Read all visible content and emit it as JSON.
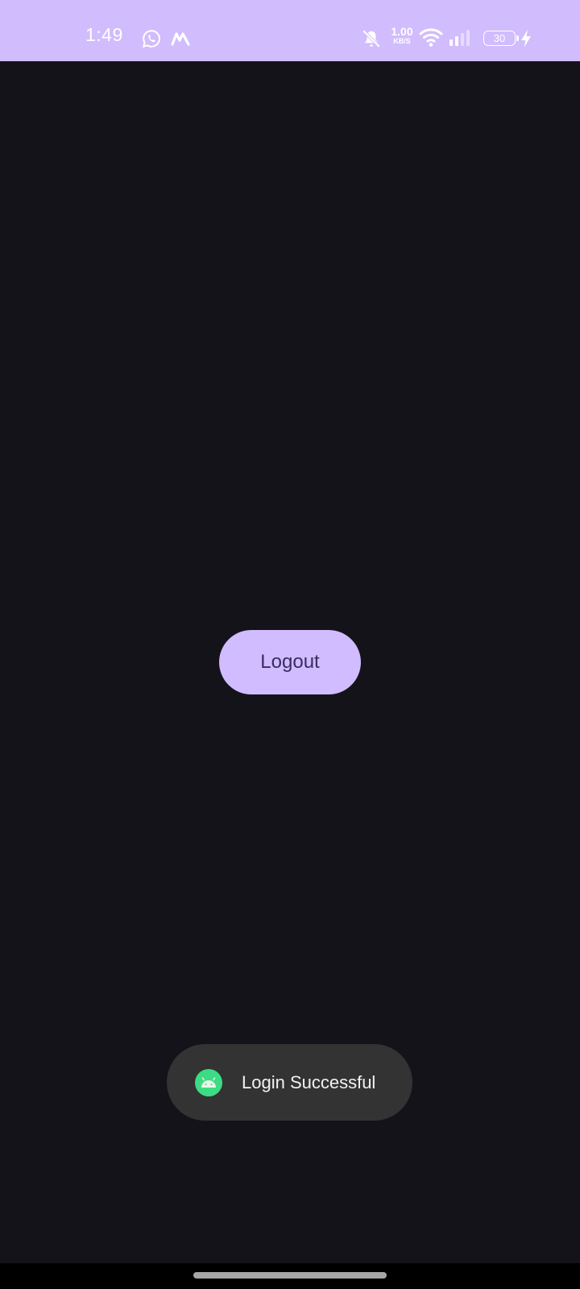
{
  "status_bar": {
    "time": "1:49",
    "notification_icons": [
      "whatsapp-icon",
      "m-app-icon"
    ],
    "mute_icon": "notifications-off-icon",
    "network_speed": {
      "value": "1.00",
      "unit": "KB/S"
    },
    "wifi_icon": "wifi-icon",
    "signal_icon": "cellular-signal-icon",
    "battery_level": "30",
    "charging_icon": "charging-bolt-icon",
    "background_color": "#d1bcfd"
  },
  "main": {
    "logout_button": {
      "label": "Logout",
      "color": "#d0bcff"
    },
    "background_color": "#15131a"
  },
  "toast": {
    "icon": "android-icon",
    "message": "Login Successful",
    "background_color": "#333333"
  },
  "navigation_bar": {
    "handle": "gesture-handle"
  }
}
